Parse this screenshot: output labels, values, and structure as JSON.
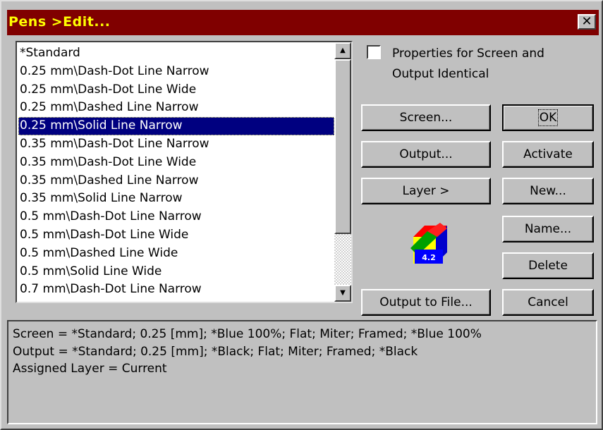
{
  "window": {
    "title": "Pens >Edit...",
    "close_glyph": "✕"
  },
  "pen_list": {
    "items": [
      "*Standard",
      "0.25 mm\\Dash-Dot Line Narrow",
      "0.25 mm\\Dash-Dot Line Wide",
      "0.25 mm\\Dashed Line Narrow",
      "0.25 mm\\Solid Line Narrow",
      "0.35 mm\\Dash-Dot Line Narrow",
      "0.35 mm\\Dash-Dot Line Wide",
      "0.35 mm\\Dashed Line Narrow",
      "0.35 mm\\Solid Line Narrow",
      "0.5 mm\\Dash-Dot Line Narrow",
      "0.5 mm\\Dash-Dot Line Wide",
      "0.5 mm\\Dashed Line Wide",
      "0.5 mm\\Solid Line Wide",
      "0.7 mm\\Dash-Dot Line Narrow"
    ],
    "selected_index": 4
  },
  "checkbox": {
    "label": "Properties for Screen and Output Identical",
    "checked": false
  },
  "buttons": {
    "screen": "Screen...",
    "output": "Output...",
    "layer": "Layer >",
    "output_to_file": "Output to File...",
    "ok": "OK",
    "activate": "Activate",
    "new": "New...",
    "name": "Name...",
    "delete": "Delete",
    "cancel": "Cancel"
  },
  "logo": {
    "version": "4.2",
    "icon": "cube-logo-icon"
  },
  "info": {
    "lines": [
      "Screen = *Standard; 0.25 [mm]; *Blue 100%; Flat; Miter; Framed; *Blue 100%",
      "Output = *Standard; 0.25 [mm]; *Black; Flat; Miter; Framed; *Black",
      "Assigned Layer = Current"
    ]
  },
  "colors": {
    "title_bg": "#800000",
    "title_text": "#ffff00",
    "selection": "#000080",
    "face": "#c0c0c0"
  }
}
